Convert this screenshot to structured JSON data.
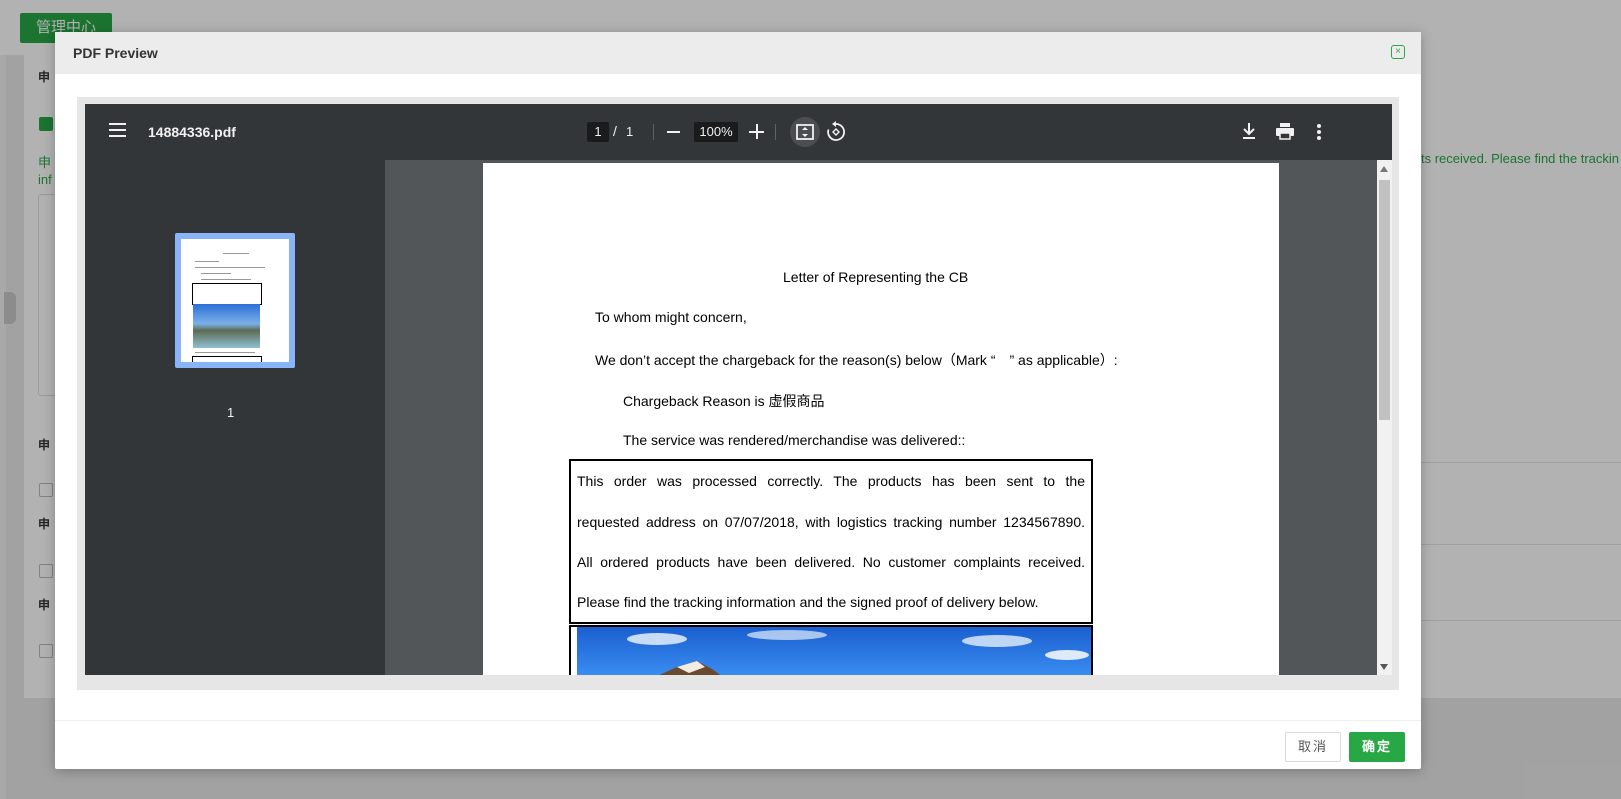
{
  "background": {
    "brand_button": "管理中心",
    "right_text": "ts received. Please find the trackin"
  },
  "modal": {
    "title": "PDF Preview",
    "cancel_label": "取消",
    "ok_label": "确定"
  },
  "viewer": {
    "filename": "14884336.pdf",
    "current_page": "1",
    "page_separator": "/",
    "total_pages": "1",
    "zoom": "100%",
    "thumbnail_label": "1",
    "colors": {
      "toolbar": "#323639",
      "sidebar": "#323639",
      "canvas": "#525659",
      "thumb_highlight": "#8ab4f8"
    }
  },
  "document": {
    "title": "Letter of Representing the CB",
    "salutation": "To whom might concern,",
    "statement": "We don’t accept the chargeback for the reason(s) below（Mark “　” as applicable）:",
    "reason": "Chargeback Reason is  虚假商品",
    "delivered": "The service was rendered/merchandise was delivered::",
    "box_lines": [
      "This order was processed correctly. The products has been sent to the",
      "requested address on 07/07/2018, with logistics tracking number 1234567890.",
      "All ordered products have been delivered. No customer complaints received.",
      "Please find the tracking information and the signed proof of delivery below."
    ]
  },
  "colors": {
    "accent": "#28a745"
  }
}
